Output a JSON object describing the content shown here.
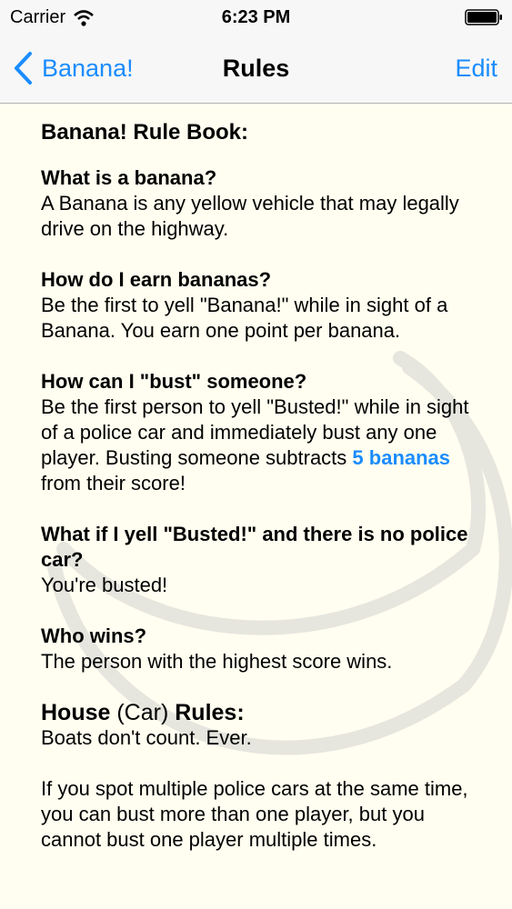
{
  "status_bar": {
    "carrier": "Carrier",
    "time": "6:23 PM"
  },
  "nav": {
    "back_label": "Banana!",
    "title": "Rules",
    "edit_label": "Edit"
  },
  "rules": {
    "book_title": "Banana! Rule Book:",
    "sections": [
      {
        "q": "What is a banana?",
        "a": "A Banana is any yellow vehicle that may legally drive on the highway."
      },
      {
        "q": "How do I earn bananas?",
        "a": "Be the first to yell \"Banana!\" while in sight of a Banana. You earn one point per banana."
      },
      {
        "q": "How can I \"bust\" someone?",
        "a_pre": "Be the first person to yell \"Busted!\" while in sight of a police car and immediately bust any one player. Busting someone subtracts",
        "a_link": "5 bananas",
        "a_post": "from their score!"
      },
      {
        "q": "What if I yell \"Busted!\" and there is no police car?",
        "a": "You're busted!"
      },
      {
        "q": "Who wins?",
        "a": "The person with the highest score wins."
      }
    ],
    "house": {
      "h1": "House",
      "h2": "(Car)",
      "h3": "Rules:",
      "p1": "Boats don't count. Ever.",
      "p2": "If you spot multiple police cars at the same time, you can bust more than one player, but you cannot bust one player multiple times."
    }
  },
  "colors": {
    "accent": "#1a8cff",
    "background": "#fffef0",
    "bar": "#f7f7f7"
  }
}
